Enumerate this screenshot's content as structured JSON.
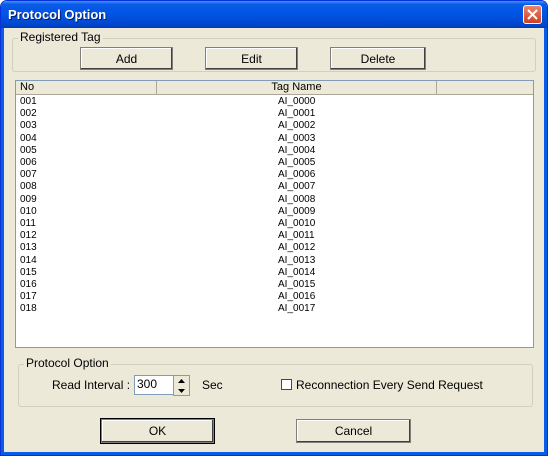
{
  "window": {
    "title": "Protocol Option"
  },
  "registered_tag": {
    "group_label": "Registered Tag",
    "add_label": "Add",
    "edit_label": "Edit",
    "delete_label": "Delete"
  },
  "tag_list": {
    "columns": [
      "No",
      "Tag Name"
    ],
    "rows": [
      [
        "001",
        "AI_0000"
      ],
      [
        "002",
        "AI_0001"
      ],
      [
        "003",
        "AI_0002"
      ],
      [
        "004",
        "AI_0003"
      ],
      [
        "005",
        "AI_0004"
      ],
      [
        "006",
        "AI_0005"
      ],
      [
        "007",
        "AI_0006"
      ],
      [
        "008",
        "AI_0007"
      ],
      [
        "009",
        "AI_0008"
      ],
      [
        "010",
        "AI_0009"
      ],
      [
        "011",
        "AI_0010"
      ],
      [
        "012",
        "AI_0011"
      ],
      [
        "013",
        "AI_0012"
      ],
      [
        "014",
        "AI_0013"
      ],
      [
        "015",
        "AI_0014"
      ],
      [
        "016",
        "AI_0015"
      ],
      [
        "017",
        "AI_0016"
      ],
      [
        "018",
        "AI_0017"
      ]
    ]
  },
  "protocol_option": {
    "group_label": "Protocol Option",
    "read_interval_label": "Read Interval :",
    "read_interval_value": "300",
    "unit_label": "Sec",
    "reconnection_label": "Reconnection Every Send Request",
    "reconnection_checked": false
  },
  "dialog_buttons": {
    "ok_label": "OK",
    "cancel_label": "Cancel"
  },
  "colors": {
    "titlebar": "#0055e5",
    "dialog_bg": "#ece9d8",
    "close_button": "#c84128"
  }
}
